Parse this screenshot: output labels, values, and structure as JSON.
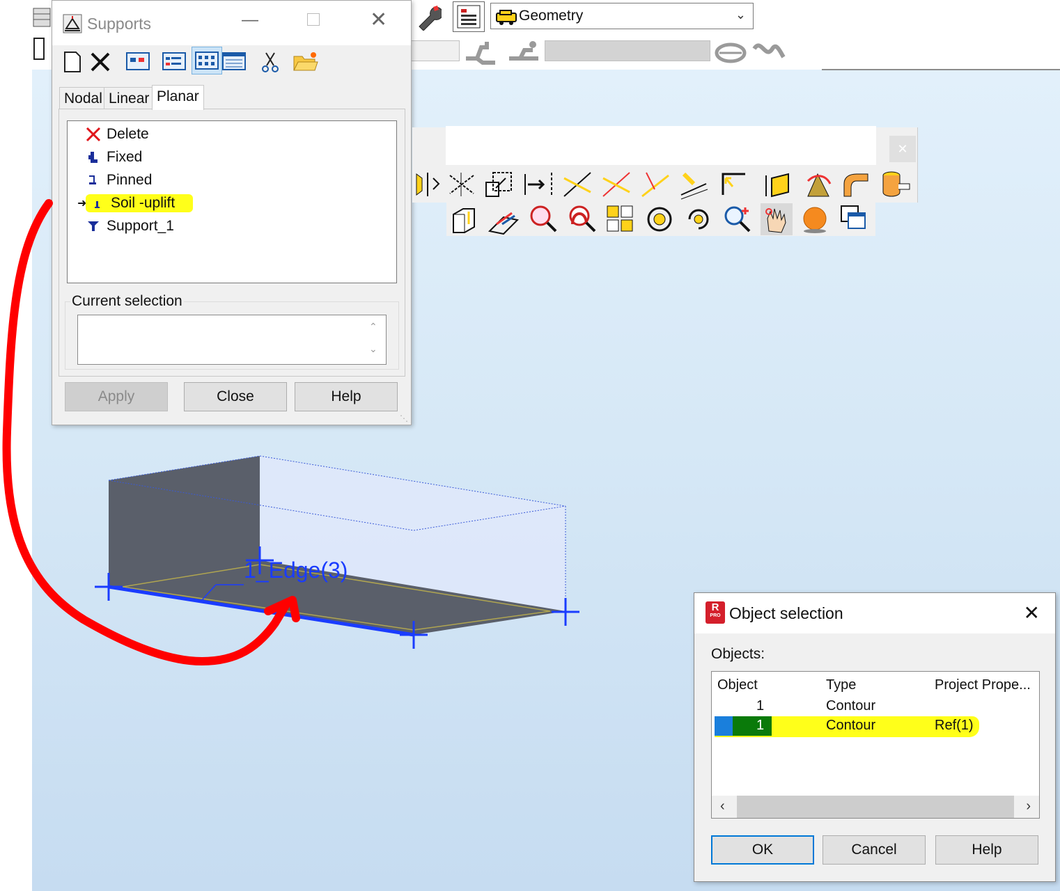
{
  "toolbar": {
    "view_combo_value": "Geometry"
  },
  "supports_dialog": {
    "title": "Supports",
    "tabs": [
      "Nodal",
      "Linear",
      "Planar"
    ],
    "active_tab": "Planar",
    "items": [
      {
        "label": "Delete",
        "icon": "red-x-icon"
      },
      {
        "label": "Fixed",
        "icon": "fixed-support-icon"
      },
      {
        "label": "Pinned",
        "icon": "pinned-support-icon"
      },
      {
        "label": "Soil -uplift",
        "icon": "soil-support-icon",
        "highlighted": true,
        "current": true
      },
      {
        "label": "Support_1",
        "icon": "support-icon"
      }
    ],
    "current_selection_label": "Current selection",
    "current_selection_value": "",
    "buttons": {
      "apply": "Apply",
      "close": "Close",
      "help": "Help"
    }
  },
  "model": {
    "edge_label": "1_Edge(3)"
  },
  "object_dialog": {
    "title": "Object selection",
    "objects_label": "Objects:",
    "columns": [
      "Object",
      "Type",
      "Project Prope..."
    ],
    "rows": [
      {
        "object": "1",
        "type": "Contour",
        "prop": ""
      },
      {
        "object": "1",
        "type": "Contour",
        "prop": "Ref(1)",
        "selected": true
      }
    ],
    "buttons": {
      "ok": "OK",
      "cancel": "Cancel",
      "help": "Help"
    }
  },
  "colors": {
    "highlight": "#ffff1a",
    "annotation": "#ff0000",
    "edge_blue": "#1a3cff",
    "selected_row": "#0a7a0a"
  }
}
